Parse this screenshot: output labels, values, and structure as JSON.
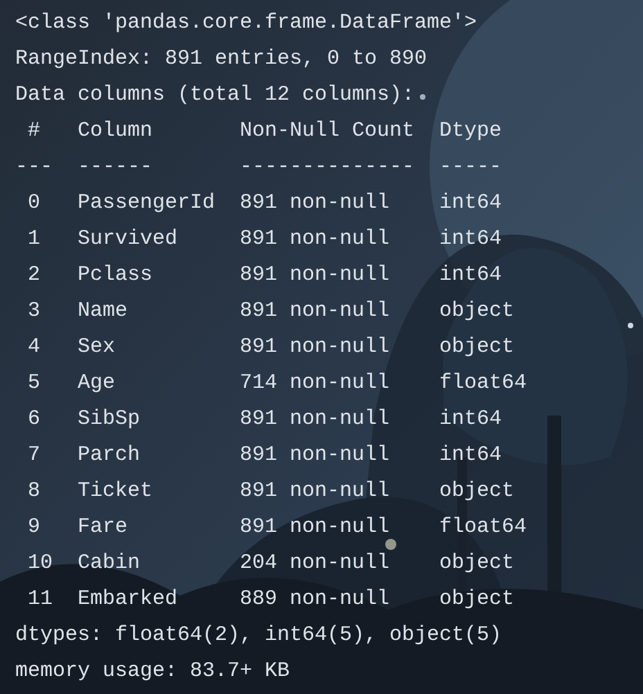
{
  "console": {
    "lines": [
      "<class 'pandas.core.frame.DataFrame'>",
      "RangeIndex: 891 entries, 0 to 890",
      "Data columns (total 12 columns):",
      " #   Column       Non-Null Count  Dtype",
      "---  ------       --------------  -----",
      " 0   PassengerId  891 non-null    int64",
      " 1   Survived     891 non-null    int64",
      " 2   Pclass       891 non-null    int64",
      " 3   Name         891 non-null    object",
      " 4   Sex          891 non-null    object",
      " 5   Age          714 non-null    float64",
      " 6   SibSp        891 non-null    int64",
      " 7   Parch        891 non-null    int64",
      " 8   Ticket       891 non-null    object",
      " 9   Fare         891 non-null    float64",
      " 10  Cabin        204 non-null    object",
      " 11  Embarked     889 non-null    object",
      "dtypes: float64(2), int64(5), object(5)",
      "memory usage: 83.7+ KB"
    ]
  }
}
